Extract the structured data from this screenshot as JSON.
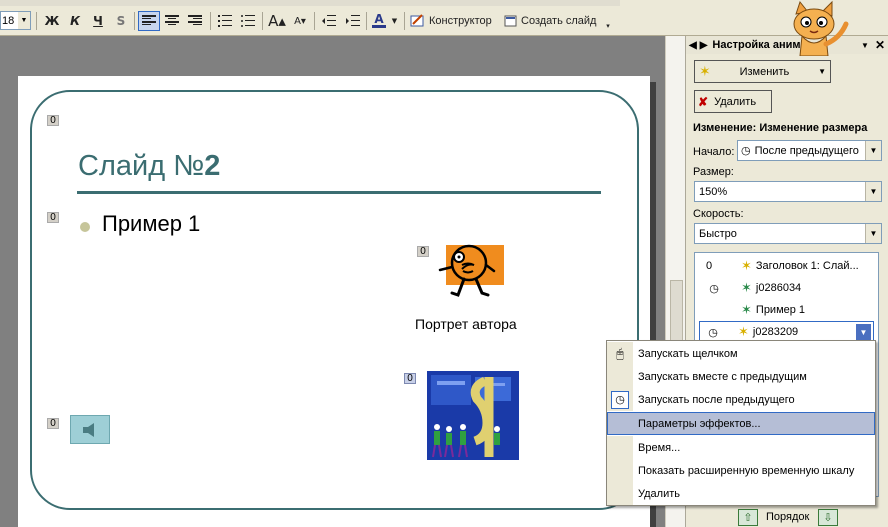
{
  "toolbar": {
    "font_size": "18",
    "bold": "Ж",
    "italic": "К",
    "underline": "Ч",
    "shadow": "S",
    "font_color_letter": "A",
    "constructor_label": "Конструктор",
    "create_slide_label": "Создать слайд"
  },
  "slide": {
    "title_prefix": "Слайд №",
    "title_number": "2",
    "bullet_text": "Пример 1",
    "picture_caption": "Портрет автора",
    "tags": [
      "0",
      "0",
      "0",
      "0",
      "0"
    ]
  },
  "task_pane": {
    "title": "Настройка аним",
    "change_button": "Изменить",
    "delete_button": "Удалить",
    "effect_heading": "Изменение: Изменение размера",
    "start_label": "Начало:",
    "start_value": "После предыдущего",
    "size_label": "Размер:",
    "size_value": "150%",
    "speed_label": "Скорость:",
    "speed_value": "Быстро",
    "list": [
      {
        "index": "0",
        "name": "Заголовок 1: Слай..."
      },
      {
        "index": "",
        "name": "j0286034"
      },
      {
        "index": "",
        "name": "Пример 1"
      },
      {
        "index": "",
        "name": "j0283209"
      }
    ],
    "order_label": "Порядок"
  },
  "context_menu": {
    "items": [
      "Запускать щелчком",
      "Запускать вместе с предыдущим",
      "Запускать после предыдущего",
      "Параметры эффектов...",
      "Время...",
      "Показать расширенную временную шкалу",
      "Удалить"
    ],
    "highlighted_index": 3
  },
  "colors": {
    "theme": "#3b6d71",
    "accent": "#316ac5",
    "toolbar_bg": "#ece9d8"
  }
}
